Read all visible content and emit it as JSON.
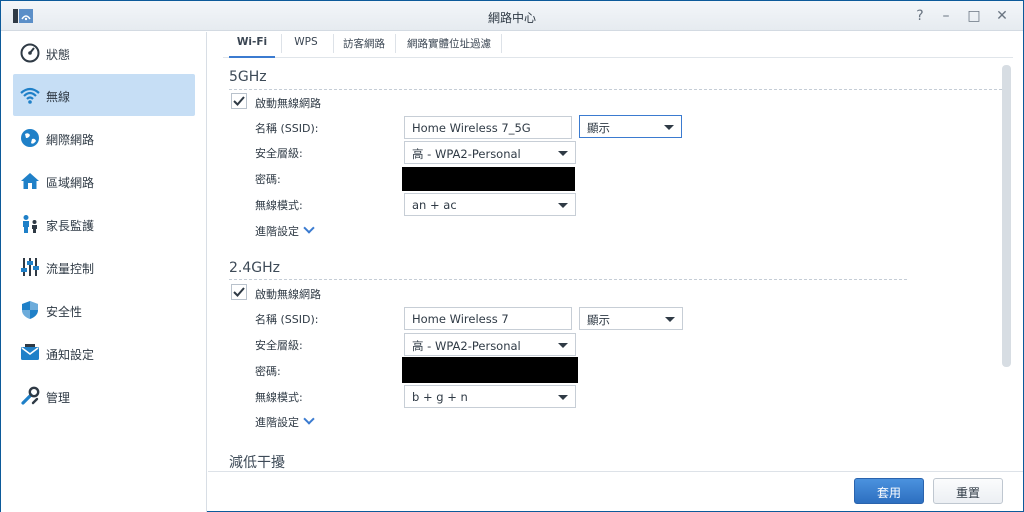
{
  "window": {
    "title": "網路中心",
    "controls": [
      "?",
      "–",
      "□",
      "✕"
    ]
  },
  "sidebar": {
    "items": [
      {
        "label": "狀態",
        "icon": "gauge-icon"
      },
      {
        "label": "無線",
        "icon": "wifi-icon",
        "active": true
      },
      {
        "label": "網際網路",
        "icon": "globe-icon"
      },
      {
        "label": "區域網路",
        "icon": "home-icon"
      },
      {
        "label": "家長監護",
        "icon": "family-icon"
      },
      {
        "label": "流量控制",
        "icon": "sliders-icon"
      },
      {
        "label": "安全性",
        "icon": "shield-icon"
      },
      {
        "label": "通知設定",
        "icon": "notification-icon"
      },
      {
        "label": "管理",
        "icon": "tools-icon"
      }
    ]
  },
  "tabs": [
    {
      "label": "Wi-Fi",
      "active": true
    },
    {
      "label": "WPS"
    },
    {
      "label": "訪客網路"
    },
    {
      "label": "網路實體位址過濾"
    }
  ],
  "band5": {
    "title": "5GHz",
    "enable_label": "啟動無線網路",
    "enabled": true,
    "ssid_label": "名稱 (SSID):",
    "ssid_value": "Home Wireless 7_5G",
    "visibility": "顯示",
    "security_label": "安全層級:",
    "security_value": "高 - WPA2-Personal",
    "password_label": "密碼:",
    "mode_label": "無線模式:",
    "mode_value": "an + ac",
    "advanced_label": "進階設定"
  },
  "band24": {
    "title": "2.4GHz",
    "enable_label": "啟動無線網路",
    "enabled": true,
    "ssid_label": "名稱 (SSID):",
    "ssid_value": "Home Wireless 7",
    "visibility": "顯示",
    "security_label": "安全層級:",
    "security_value": "高 - WPA2-Personal",
    "password_label": "密碼:",
    "mode_label": "無線模式:",
    "mode_value": "b + g + n",
    "advanced_label": "進階設定"
  },
  "interference": {
    "title": "減低干擾"
  },
  "footer": {
    "apply_label": "套用",
    "reset_label": "重置"
  },
  "colors": {
    "accent": "#3b7bd0",
    "active_bg": "#c6def5",
    "primary_btn": "#2d6fc0"
  }
}
